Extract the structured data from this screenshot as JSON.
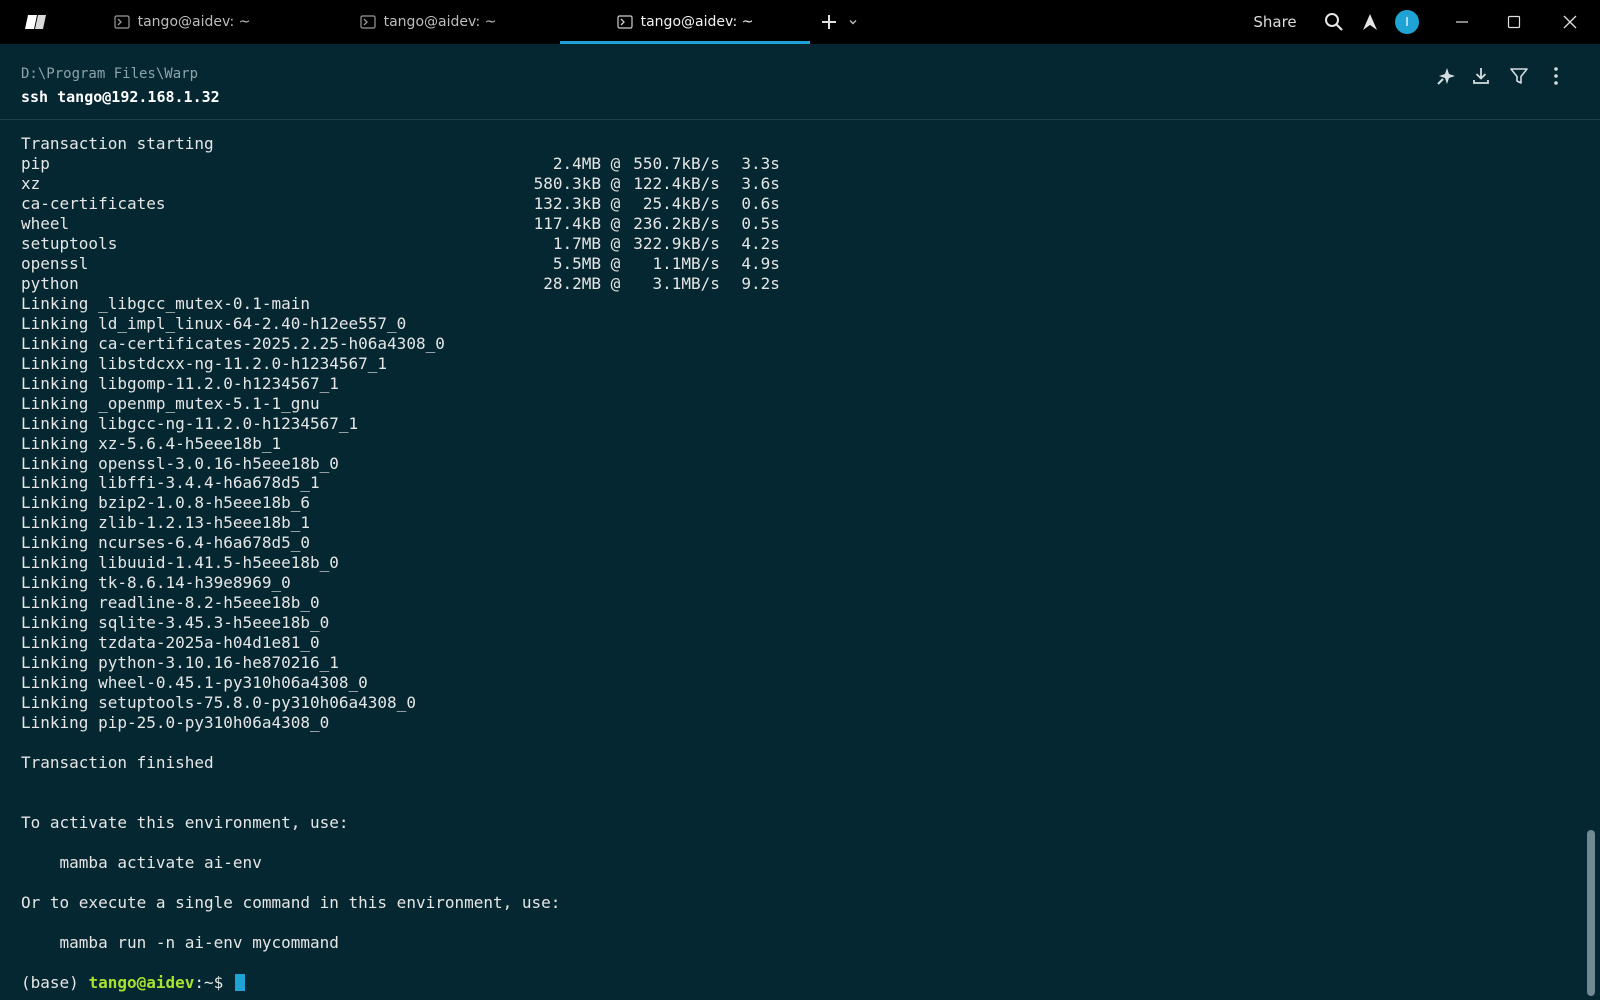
{
  "tabs": [
    {
      "label": "tango@aidev: ~",
      "active": false
    },
    {
      "label": "tango@aidev: ~",
      "active": false
    },
    {
      "label": "tango@aidev: ~",
      "active": true
    }
  ],
  "titlebar": {
    "share_label": "Share",
    "avatar_initial": "I",
    "icons": [
      "new-tab-icon",
      "chevron-down-icon",
      "search-icon",
      "warp-ai-icon",
      "minimize-icon",
      "maximize-icon",
      "close-icon"
    ]
  },
  "block": {
    "path": "D:\\Program Files\\Warp",
    "command": "ssh tango@192.168.1.32",
    "tool_icons": [
      "sparkle-icon",
      "download-icon",
      "filter-icon",
      "more-vertical-icon"
    ]
  },
  "colors": {
    "accent": "#1da1d8",
    "background": "#052731",
    "prompt_user": "#a6e22e"
  },
  "output": {
    "transaction_start": "Transaction starting",
    "downloads": [
      {
        "name": "pip",
        "size": "2.4MB",
        "rate": "550.7kB/s",
        "time": "3.3s"
      },
      {
        "name": "xz",
        "size": "580.3kB",
        "rate": "122.4kB/s",
        "time": "3.6s"
      },
      {
        "name": "ca-certificates",
        "size": "132.3kB",
        "rate": "25.4kB/s",
        "time": "0.6s"
      },
      {
        "name": "wheel",
        "size": "117.4kB",
        "rate": "236.2kB/s",
        "time": "0.5s"
      },
      {
        "name": "setuptools",
        "size": "1.7MB",
        "rate": "322.9kB/s",
        "time": "4.2s"
      },
      {
        "name": "openssl",
        "size": "5.5MB",
        "rate": "1.1MB/s",
        "time": "4.9s"
      },
      {
        "name": "python",
        "size": "28.2MB",
        "rate": "3.1MB/s",
        "time": "9.2s"
      }
    ],
    "linking": [
      "Linking _libgcc_mutex-0.1-main",
      "Linking ld_impl_linux-64-2.40-h12ee557_0",
      "Linking ca-certificates-2025.2.25-h06a4308_0",
      "Linking libstdcxx-ng-11.2.0-h1234567_1",
      "Linking libgomp-11.2.0-h1234567_1",
      "Linking _openmp_mutex-5.1-1_gnu",
      "Linking libgcc-ng-11.2.0-h1234567_1",
      "Linking xz-5.6.4-h5eee18b_1",
      "Linking openssl-3.0.16-h5eee18b_0",
      "Linking libffi-3.4.4-h6a678d5_1",
      "Linking bzip2-1.0.8-h5eee18b_6",
      "Linking zlib-1.2.13-h5eee18b_1",
      "Linking ncurses-6.4-h6a678d5_0",
      "Linking libuuid-1.41.5-h5eee18b_0",
      "Linking tk-8.6.14-h39e8969_0",
      "Linking readline-8.2-h5eee18b_0",
      "Linking sqlite-3.45.3-h5eee18b_0",
      "Linking tzdata-2025a-h04d1e81_0",
      "Linking python-3.10.16-he870216_1",
      "Linking wheel-0.45.1-py310h06a4308_0",
      "Linking setuptools-75.8.0-py310h06a4308_0",
      "Linking pip-25.0-py310h06a4308_0"
    ],
    "transaction_finished": "Transaction finished",
    "activate_hint": "To activate this environment, use:",
    "activate_cmd": "    mamba activate ai-env",
    "run_hint": "Or to execute a single command in this environment, use:",
    "run_cmd": "    mamba run -n ai-env mycommand"
  },
  "prompt": {
    "env": "(base) ",
    "user": "tango@aidev",
    "rest": ":~$ "
  }
}
